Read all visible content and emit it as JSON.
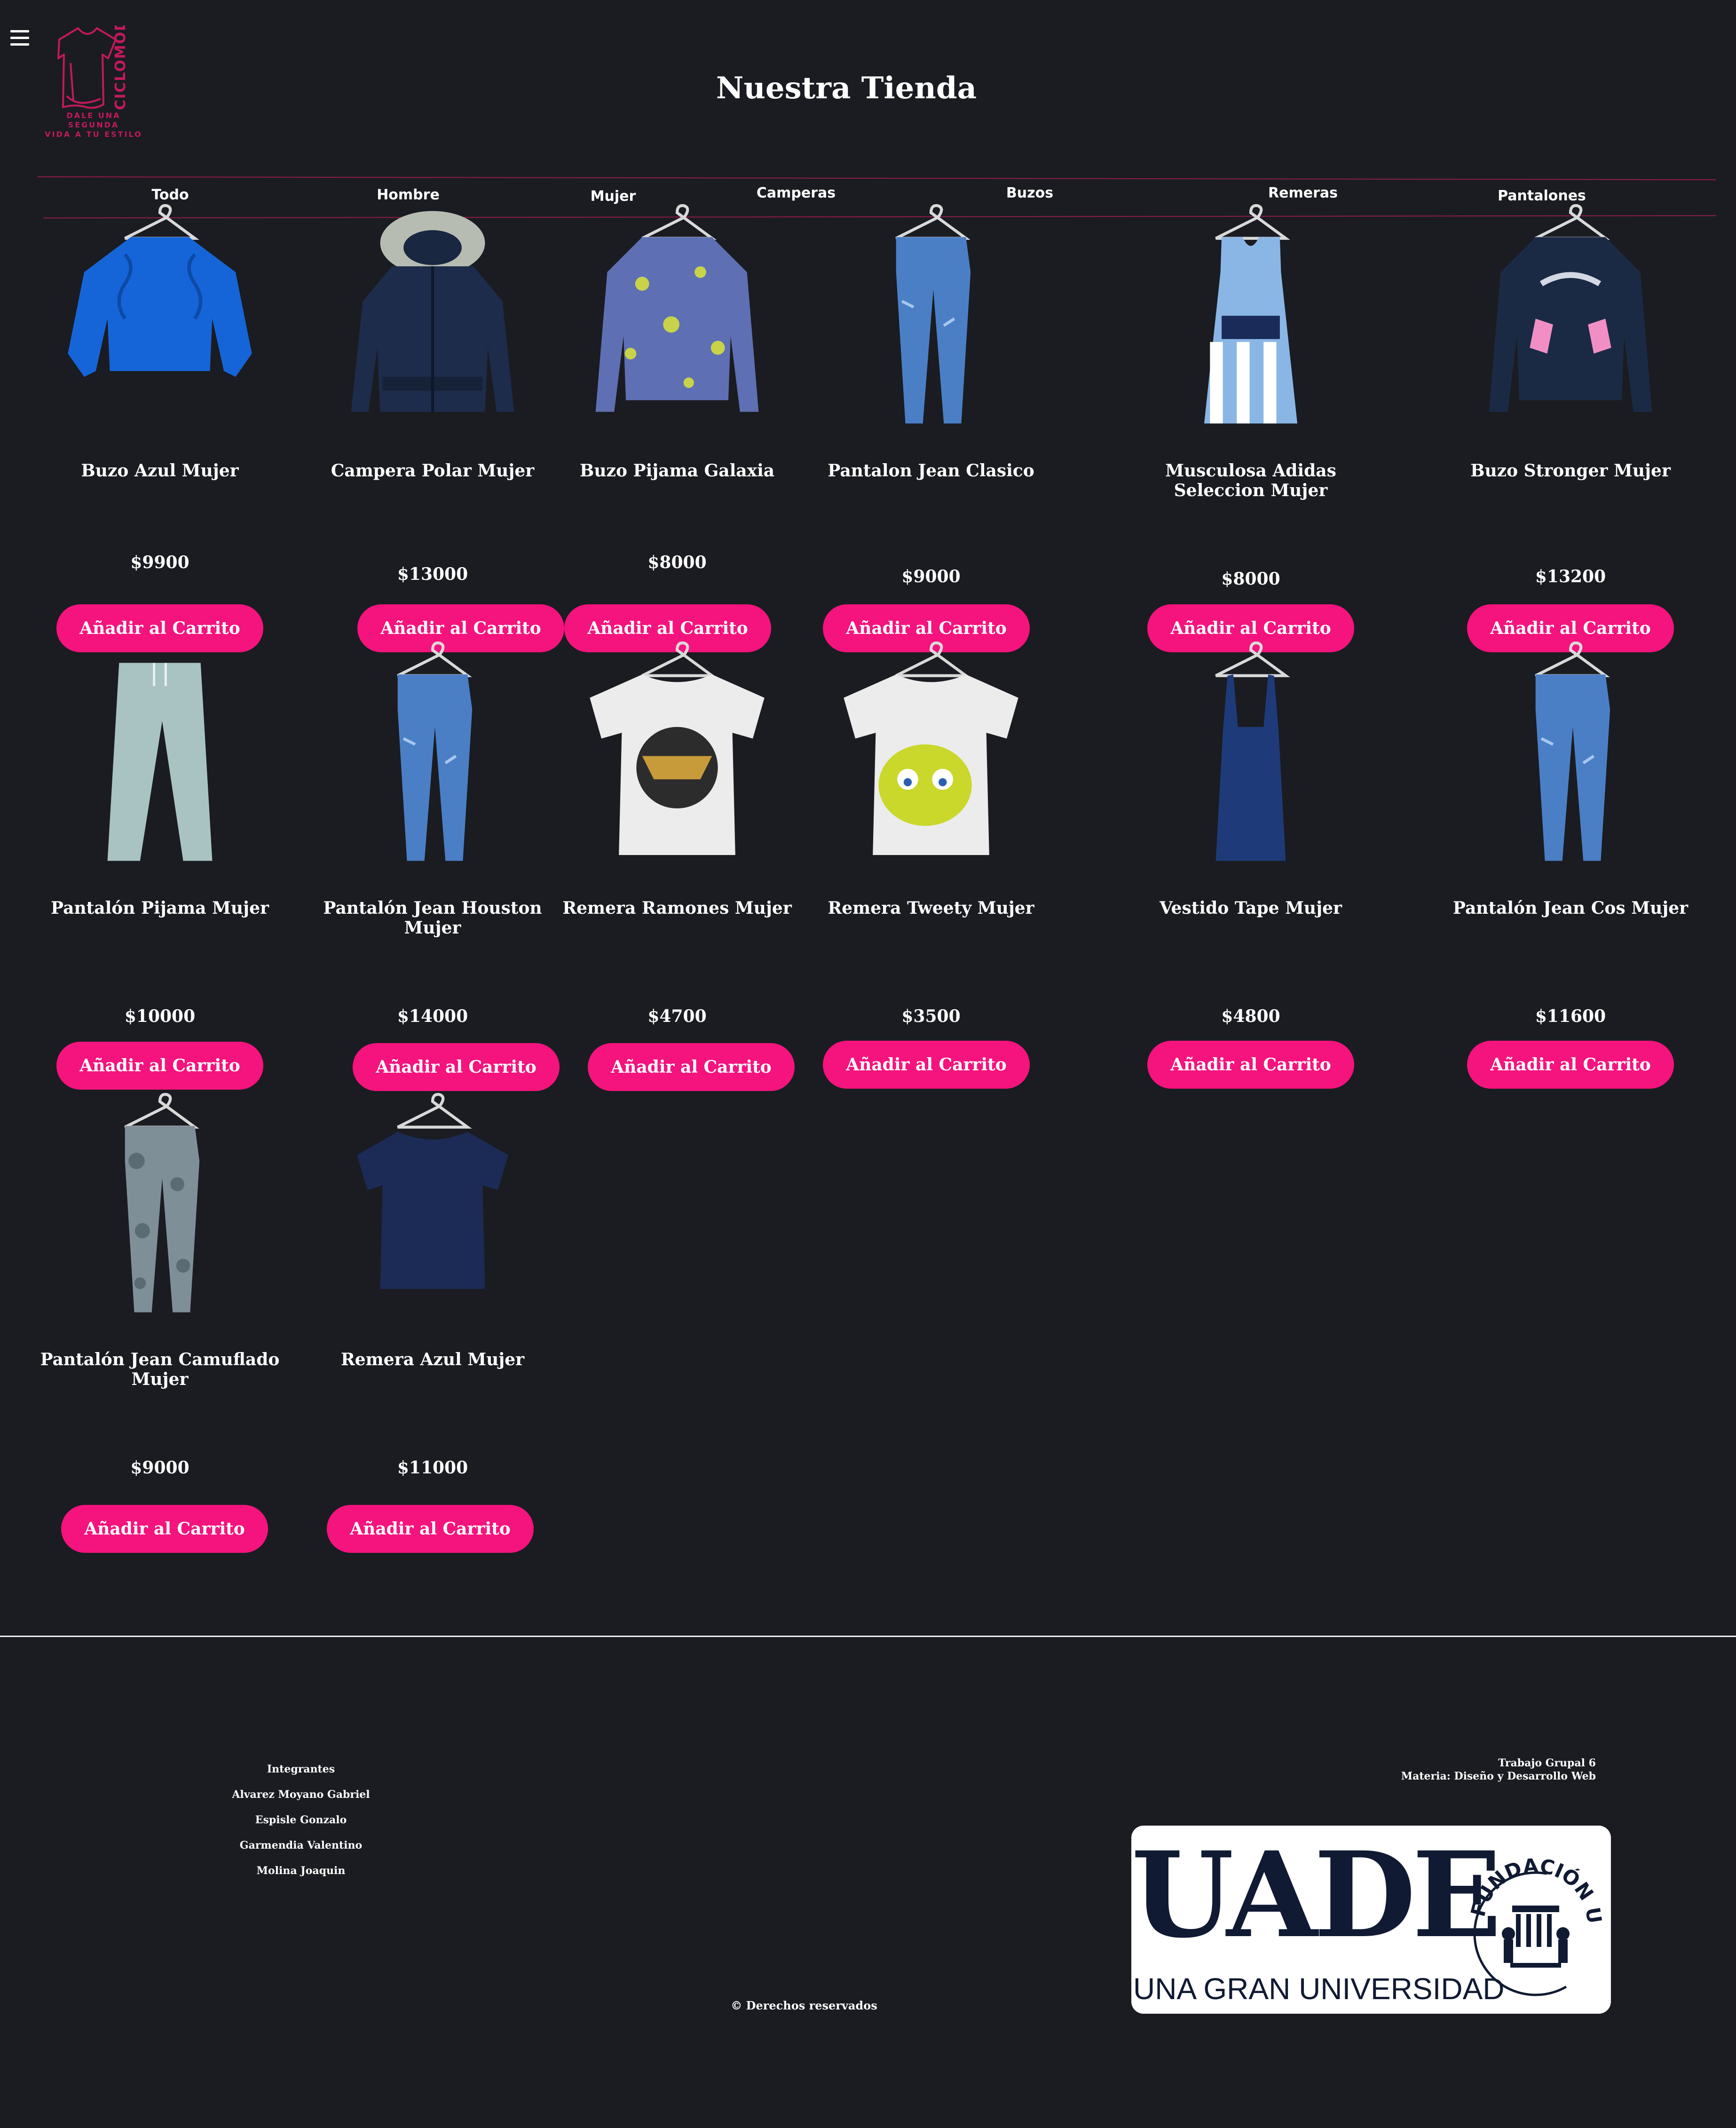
{
  "header": {
    "menu_icon": "hamburger-icon",
    "logo_text": "CICLOMODA",
    "logo_tagline_1": "DALE UNA SEGUNDA",
    "logo_tagline_2": "VIDA A TU ESTILO",
    "title": "Nuestra Tienda"
  },
  "colors": {
    "background": "#1a1c21",
    "accent": "#f5137d",
    "brand": "#c3195d",
    "nav_line": "#8e1d4a"
  },
  "nav": [
    "Todo",
    "Hombre",
    "Mujer",
    "Camperas",
    "Buzos",
    "Remeras",
    "Pantalones"
  ],
  "products": [
    {
      "name": "Buzo Azul Mujer",
      "price": "$9900",
      "button": "Añadir al Carrito",
      "image": "blue-sweater"
    },
    {
      "name": "Campera Polar Mujer",
      "price": "$13000",
      "button": "Añadir al Carrito",
      "image": "navy-parka"
    },
    {
      "name": "Buzo Pijama Galaxia",
      "price": "$8000",
      "button": "Añadir al Carrito",
      "image": "galaxy-hoodie"
    },
    {
      "name": "Pantalon Jean Clasico",
      "price": "$9000",
      "button": "Añadir al Carrito",
      "image": "jeans"
    },
    {
      "name": "Musculosa Adidas Seleccion Mujer",
      "price": "$8000",
      "button": "Añadir al Carrito",
      "image": "jersey"
    },
    {
      "name": "Buzo Stronger Mujer",
      "price": "$13200",
      "button": "Añadir al Carrito",
      "image": "stronger-hoodie"
    },
    {
      "name": "Pantalón Pijama Mujer",
      "price": "$10000",
      "button": "Añadir al Carrito",
      "image": "pajama-pants"
    },
    {
      "name": "Pantalón Jean Houston Mujer",
      "price": "$14000",
      "button": "Añadir al Carrito",
      "image": "jeans"
    },
    {
      "name": "Remera Ramones Mujer",
      "price": "$4700",
      "button": "Añadir al Carrito",
      "image": "ramones-tee"
    },
    {
      "name": "Remera Tweety Mujer",
      "price": "$3500",
      "button": "Añadir al Carrito",
      "image": "tweety-tee"
    },
    {
      "name": "Vestido Tape Mujer",
      "price": "$4800",
      "button": "Añadir al Carrito",
      "image": "navy-dress"
    },
    {
      "name": "Pantalón Jean Cos Mujer",
      "price": "$11600",
      "button": "Añadir al Carrito",
      "image": "jeans"
    },
    {
      "name": "Pantalón Jean Camuflado Mujer",
      "price": "$9000",
      "button": "Añadir al Carrito",
      "image": "camo-jeans"
    },
    {
      "name": "Remera Azul Mujer",
      "price": "$11000",
      "button": "Añadir al Carrito",
      "image": "navy-tee"
    }
  ],
  "footer": {
    "team_title": "Integrantes",
    "members": [
      "Alvarez Moyano Gabriel",
      "Espisle Gonzalo",
      "Garmendia Valentino",
      "Molina Joaquin"
    ],
    "course_1": "Trabajo Grupal 6",
    "course_2": "Materia: Diseño y Desarrollo Web",
    "copyright": "© Derechos reservados",
    "uade_big": "UADE",
    "uade_sub": "UNA GRAN UNIVERSIDAD",
    "uade_seal": "FUNDACIÓN UADE"
  }
}
